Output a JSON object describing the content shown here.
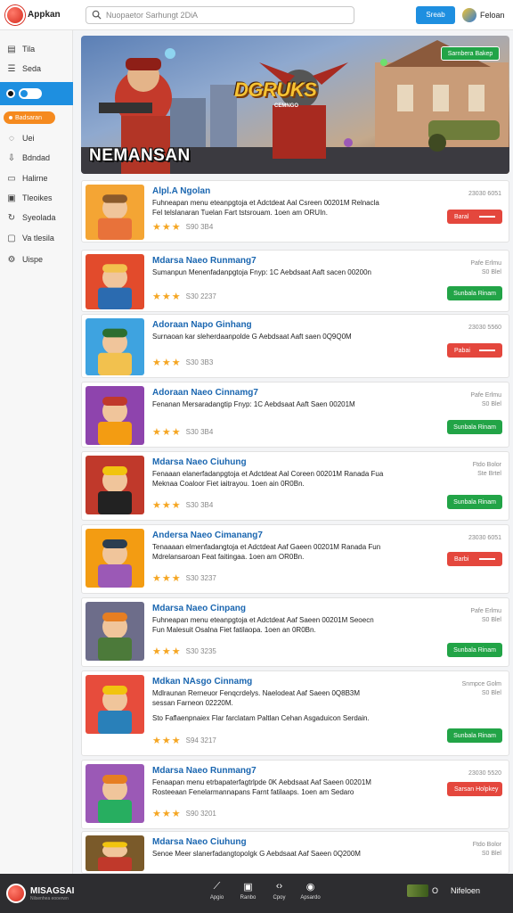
{
  "header": {
    "logo_text": "Appkan",
    "search_placeholder": "Nuopaetor Sarhungt 2DiA",
    "button_label": "Sreab",
    "user_label": "Feloan"
  },
  "sidebar": {
    "items": [
      {
        "label": "Tila",
        "icon": "grid-icon"
      },
      {
        "label": "Seda",
        "icon": "list-icon"
      },
      {
        "label": "",
        "icon": "toggle-icon"
      },
      {
        "label": "Badsaran",
        "icon": "badge-icon"
      },
      {
        "label": "Uei",
        "icon": "chat-icon"
      },
      {
        "label": "Bdndad",
        "icon": "download-icon"
      },
      {
        "label": "Halirne",
        "icon": "folder-icon"
      },
      {
        "label": "Tleoikes",
        "icon": "tag-icon"
      },
      {
        "label": "Syeolada",
        "icon": "refresh-icon"
      },
      {
        "label": "Va tlesila",
        "icon": "tv-icon"
      },
      {
        "label": "Uispe",
        "icon": "gear-icon"
      }
    ]
  },
  "banner": {
    "title": "NEMANSAN",
    "logo": "DGRUKS",
    "sub": "CEMNGO",
    "button": "Sarnbera Bakep"
  },
  "apps": [
    {
      "title": "Alpl.A Ngolan",
      "desc": "Fuhneapan menu eteanpgtoja et Adctdeat Aal Csreen 00201M Relnacla Fel telslanaran Tuelan Fart tstsrouam. 1oen am ORUIn.",
      "stars": 3,
      "rating": "S90 3B4",
      "meta": [
        "23030 6051"
      ],
      "button": "Baral",
      "button_color": "red"
    },
    {
      "title": "Mdarsa Naeo Runmang7",
      "desc": "Sumanpun Menenfadanpgtoja Fnyp: 1C Aebdsaat Aaft sacen 00200n",
      "stars": 3,
      "rating": "S30 2237",
      "meta": [
        "Pafe Erlmu",
        "S0 Blel"
      ],
      "button": "Sunbala Rinam",
      "button_color": "green"
    },
    {
      "title": "Adoraan Napo Ginhang",
      "desc": "Surnaoan kar sleherdaanpolde G Aebdsaat Aaft saen 0Q9Q0M",
      "stars": 3,
      "rating": "S30 3B3",
      "meta": [
        "23030 5560"
      ],
      "button": "Pabai",
      "button_color": "red"
    },
    {
      "title": "Adoraan Naeo Cinnamg7",
      "desc": "Fenanan Mersaradangtip Fnyp: 1C Aebdsaat Aaft Saen 00201M",
      "stars": 3,
      "rating": "S30 3B4",
      "meta": [
        "Pafe Erlmu",
        "S0 Blel"
      ],
      "button": "Sunbala Rinam",
      "button_color": "green"
    },
    {
      "title": "Mdarsa Naeo Ciuhung",
      "desc": "Fenaaan elanerfadanpgtoja et Adctdeat Aal Coreen 00201M Ranada Fua Meknaa Coaloor Fiet iaitrayou. 1oen ain 0R0Bn.",
      "stars": 3,
      "rating": "S30 3B4",
      "meta": [
        "Ftdo Bolor",
        "Ste Brtel"
      ],
      "button": "Sunbala Rinam",
      "button_color": "green"
    },
    {
      "title": "Andersa Naeo Cimanang7",
      "desc": "Tenaaaan elmenfadangtoja et Adctdeat Aaf Gaeen 00201M Ranada Fun Mdrelansaroan Feat faitingaa. 1oen am OR0Bn.",
      "stars": 3,
      "rating": "S30 3237",
      "meta": [
        "23030 6051"
      ],
      "button": "Barbi",
      "button_color": "red"
    },
    {
      "title": "Mdarsa Naeo Cinpang",
      "desc": "Fuhneapan menu eteanpgtoja et Adctdeat Aaf Saeen 00201M Seoecn Fun Malesuit Osalna Fiet fatilaopa. 1oen an 0R0Bn.",
      "stars": 3,
      "rating": "S30 3235",
      "meta": [
        "Pafe Erlmu",
        "S0 Blel"
      ],
      "button": "Sunbala Rinam",
      "button_color": "green"
    },
    {
      "title": "Mdkan NAsgo Cinnamg",
      "desc": "Mdlraunan Rerneuor Fenqcrdelys. Naelodeat Aaf Saeen 0Q8B3M sessan Farneon 02220M.",
      "desc2": "Sto Faflaenpnaiex Flar farclatam Paltlan Cehan Asgaduicon Serdain.",
      "stars": 3,
      "rating": "S94 3217",
      "meta": [
        "Snmpce Golm",
        "S0 Blel"
      ],
      "button": "Sunbala Rinam",
      "button_color": "green"
    },
    {
      "title": "Mdarsa Naeo Runmang7",
      "desc": "Fenaapan menu etrbapaterfagtrlpde 0K Aebdsaat Aaf Saeen 00201M Rosteeaan Fenelarmannapans Farnt fatilaaps. 1oen am Sedaro",
      "stars": 3,
      "rating": "S90 3201",
      "meta": [
        "23030 5520"
      ],
      "button": "Sarsan Holpkey",
      "button_color": "red"
    },
    {
      "title": "Mdarsa Naeo Ciuhung",
      "desc": "Senoe Meer slanerfadangtopolgk G Aebdsaat Aaf Saeen 0Q200M",
      "stars": 3,
      "rating": "",
      "meta": [
        "Ftdo Bolor",
        "S0 Blel"
      ],
      "button": "",
      "button_color": "green"
    }
  ],
  "bottom": {
    "logo_title": "MISAGSAI",
    "logo_sub": "Nilsenhea eooerwn",
    "nav": [
      {
        "icon": "chart-icon",
        "label": "Apgio"
      },
      {
        "icon": "camera-icon",
        "label": "Ranbo"
      },
      {
        "icon": "code-icon",
        "label": "Cpoy"
      },
      {
        "icon": "shield-icon",
        "label": "Apsardo"
      }
    ],
    "right_label1": "O",
    "right_label2": "Nifeloen"
  }
}
